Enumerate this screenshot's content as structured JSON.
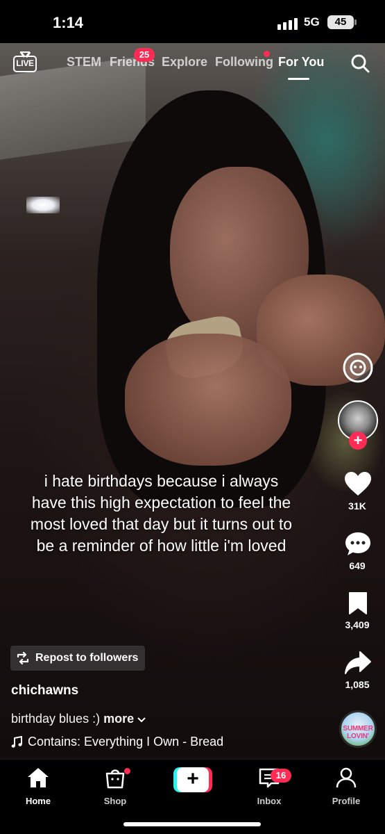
{
  "status_bar": {
    "time": "1:14",
    "network": "5G",
    "battery": "45"
  },
  "top_nav": {
    "live_label": "LIVE",
    "tabs": [
      {
        "label": "STEM"
      },
      {
        "label": "Friends",
        "badge": "25"
      },
      {
        "label": "Explore"
      },
      {
        "label": "Following",
        "has_dot": true
      },
      {
        "label": "For You",
        "active": true
      }
    ]
  },
  "video": {
    "overlay_text": "i hate birthdays because i always have this high expectation to feel the most loved that day but it turns out to be a reminder of how little i'm loved"
  },
  "actions": {
    "likes": "31K",
    "comments": "649",
    "saves": "3,409",
    "shares": "1,085",
    "sound_disc_text": "SUMMER LOVIN'"
  },
  "post": {
    "repost_label": "Repost to followers",
    "username": "chichawns",
    "description": "birthday blues :)",
    "more_label": "more",
    "music": "Contains: Everything I Own - Bread"
  },
  "bottom_nav": {
    "items": [
      {
        "label": "Home",
        "active": true
      },
      {
        "label": "Shop",
        "has_dot": true
      },
      {
        "label": "Inbox",
        "badge": "16"
      },
      {
        "label": "Profile"
      }
    ]
  },
  "colors": {
    "accent": "#fe2c55",
    "cyan": "#25f4ee",
    "background": "#000000"
  }
}
